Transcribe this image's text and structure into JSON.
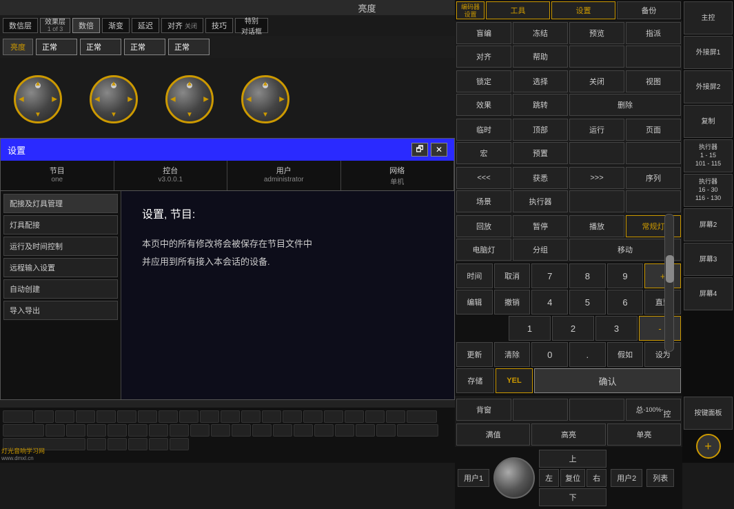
{
  "topBar": {
    "title": "亮度"
  },
  "encoderRow": {
    "dataLayer": "数信层",
    "effectLayer": "效果层",
    "effectLayerSub": "1 of 3",
    "double": "数倍",
    "blend": "渐变",
    "delay": "延迟",
    "align": "对齐",
    "alignSub": "关闭",
    "tips": "技巧",
    "special": "特别\n对话框"
  },
  "channelRow": {
    "brightness": "亮度",
    "normal1": "正常",
    "normal2": "正常",
    "normal3": "正常",
    "normal4": "正常"
  },
  "dialog": {
    "title": "设置",
    "closeBtn": "✕",
    "minBtn": "🗗",
    "tabs": [
      {
        "label": "节目",
        "sub": "one"
      },
      {
        "label": "控台",
        "sub": "v3.0.0.1"
      },
      {
        "label": "用户",
        "sub": "administrator"
      },
      {
        "label": "网络",
        "sub": "单机"
      }
    ],
    "sidebar": [
      "配接及灯具管理",
      "灯具配接",
      "运行及时间控制",
      "远程输入设置",
      "自动创建",
      "导入导出"
    ],
    "contentTitle": "设置, 节目:",
    "contentText": "本页中的所有修改将会被保存在节目文件中\n并应用到所有接入本会话的设备."
  },
  "rightPanel": {
    "encoderSettings": "编码器\n设置",
    "topBtns": [
      "工具",
      "设置",
      "备份"
    ],
    "row1": [
      "盲编",
      "冻结",
      "预览",
      "指派",
      "对齐",
      "帮助"
    ],
    "row2": [
      "锁定",
      "选择",
      "关闭",
      "视图",
      "效果",
      "跳转",
      "删除"
    ],
    "row3": [
      "临时",
      "顶部",
      "运行",
      "页面",
      "宏",
      "预置"
    ],
    "row4": [
      "<<<",
      "获悉",
      ">>>",
      "序列",
      "场景",
      "执行器"
    ],
    "row5": [
      "回放",
      "暂停",
      "播放",
      "常规灯",
      "电脑灯",
      "分组",
      "移动"
    ],
    "numpad": {
      "time": "时间",
      "cancel": "取消",
      "n7": "7",
      "n8": "8",
      "n9": "9",
      "plus": "+",
      "edit": "编辑",
      "undo": "撤销",
      "n4": "4",
      "n5": "5",
      "n6": "6",
      "goto": "直到",
      "n1": "1",
      "n2": "2",
      "n3": "3",
      "minus": "-",
      "update": "更新",
      "clear": "清除",
      "n0": "0",
      "dot": ".",
      "ifonly": "假如",
      "set": "设为",
      "store": "存储",
      "yel": "YEL",
      "confirm": "确认",
      "backwindow": "背窗",
      "full": "满值",
      "high": "高亮",
      "solo": "单亮",
      "user1": "用户1",
      "user2": "用户2",
      "list": "列表",
      "up": "上",
      "left": "左",
      "reset": "复位",
      "right": "右",
      "down": "下",
      "total": "总\n-100%-\n控"
    },
    "farRight": {
      "main": "主控",
      "ext1": "外接屏1",
      "ext2": "外接屏2",
      "copy": "复制",
      "exec1": "执行器\n1 - 15\n101 - 115",
      "exec2": "执行器\n16 - 30\n116 - 130",
      "screen2": "屏幕2",
      "screen3": "屏幕3",
      "screen4": "屏幕4",
      "keypad": "按键面板",
      "pct": "-100%-"
    }
  },
  "keyboard": {
    "label": "灯光音响学习网\nwww.dmxl.cn"
  }
}
